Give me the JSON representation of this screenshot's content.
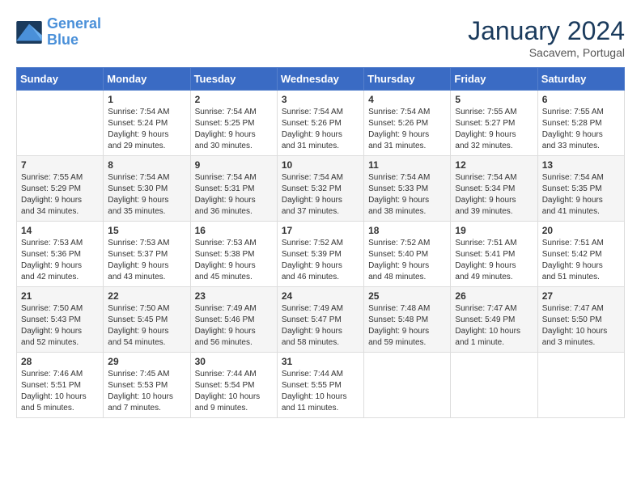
{
  "header": {
    "logo_line1": "General",
    "logo_line2": "Blue",
    "month_year": "January 2024",
    "location": "Sacavem, Portugal"
  },
  "weekdays": [
    "Sunday",
    "Monday",
    "Tuesday",
    "Wednesday",
    "Thursday",
    "Friday",
    "Saturday"
  ],
  "weeks": [
    [
      {
        "day": "",
        "info": ""
      },
      {
        "day": "1",
        "info": "Sunrise: 7:54 AM\nSunset: 5:24 PM\nDaylight: 9 hours\nand 29 minutes."
      },
      {
        "day": "2",
        "info": "Sunrise: 7:54 AM\nSunset: 5:25 PM\nDaylight: 9 hours\nand 30 minutes."
      },
      {
        "day": "3",
        "info": "Sunrise: 7:54 AM\nSunset: 5:26 PM\nDaylight: 9 hours\nand 31 minutes."
      },
      {
        "day": "4",
        "info": "Sunrise: 7:54 AM\nSunset: 5:26 PM\nDaylight: 9 hours\nand 31 minutes."
      },
      {
        "day": "5",
        "info": "Sunrise: 7:55 AM\nSunset: 5:27 PM\nDaylight: 9 hours\nand 32 minutes."
      },
      {
        "day": "6",
        "info": "Sunrise: 7:55 AM\nSunset: 5:28 PM\nDaylight: 9 hours\nand 33 minutes."
      }
    ],
    [
      {
        "day": "7",
        "info": "Sunrise: 7:55 AM\nSunset: 5:29 PM\nDaylight: 9 hours\nand 34 minutes."
      },
      {
        "day": "8",
        "info": "Sunrise: 7:54 AM\nSunset: 5:30 PM\nDaylight: 9 hours\nand 35 minutes."
      },
      {
        "day": "9",
        "info": "Sunrise: 7:54 AM\nSunset: 5:31 PM\nDaylight: 9 hours\nand 36 minutes."
      },
      {
        "day": "10",
        "info": "Sunrise: 7:54 AM\nSunset: 5:32 PM\nDaylight: 9 hours\nand 37 minutes."
      },
      {
        "day": "11",
        "info": "Sunrise: 7:54 AM\nSunset: 5:33 PM\nDaylight: 9 hours\nand 38 minutes."
      },
      {
        "day": "12",
        "info": "Sunrise: 7:54 AM\nSunset: 5:34 PM\nDaylight: 9 hours\nand 39 minutes."
      },
      {
        "day": "13",
        "info": "Sunrise: 7:54 AM\nSunset: 5:35 PM\nDaylight: 9 hours\nand 41 minutes."
      }
    ],
    [
      {
        "day": "14",
        "info": "Sunrise: 7:53 AM\nSunset: 5:36 PM\nDaylight: 9 hours\nand 42 minutes."
      },
      {
        "day": "15",
        "info": "Sunrise: 7:53 AM\nSunset: 5:37 PM\nDaylight: 9 hours\nand 43 minutes."
      },
      {
        "day": "16",
        "info": "Sunrise: 7:53 AM\nSunset: 5:38 PM\nDaylight: 9 hours\nand 45 minutes."
      },
      {
        "day": "17",
        "info": "Sunrise: 7:52 AM\nSunset: 5:39 PM\nDaylight: 9 hours\nand 46 minutes."
      },
      {
        "day": "18",
        "info": "Sunrise: 7:52 AM\nSunset: 5:40 PM\nDaylight: 9 hours\nand 48 minutes."
      },
      {
        "day": "19",
        "info": "Sunrise: 7:51 AM\nSunset: 5:41 PM\nDaylight: 9 hours\nand 49 minutes."
      },
      {
        "day": "20",
        "info": "Sunrise: 7:51 AM\nSunset: 5:42 PM\nDaylight: 9 hours\nand 51 minutes."
      }
    ],
    [
      {
        "day": "21",
        "info": "Sunrise: 7:50 AM\nSunset: 5:43 PM\nDaylight: 9 hours\nand 52 minutes."
      },
      {
        "day": "22",
        "info": "Sunrise: 7:50 AM\nSunset: 5:45 PM\nDaylight: 9 hours\nand 54 minutes."
      },
      {
        "day": "23",
        "info": "Sunrise: 7:49 AM\nSunset: 5:46 PM\nDaylight: 9 hours\nand 56 minutes."
      },
      {
        "day": "24",
        "info": "Sunrise: 7:49 AM\nSunset: 5:47 PM\nDaylight: 9 hours\nand 58 minutes."
      },
      {
        "day": "25",
        "info": "Sunrise: 7:48 AM\nSunset: 5:48 PM\nDaylight: 9 hours\nand 59 minutes."
      },
      {
        "day": "26",
        "info": "Sunrise: 7:47 AM\nSunset: 5:49 PM\nDaylight: 10 hours\nand 1 minute."
      },
      {
        "day": "27",
        "info": "Sunrise: 7:47 AM\nSunset: 5:50 PM\nDaylight: 10 hours\nand 3 minutes."
      }
    ],
    [
      {
        "day": "28",
        "info": "Sunrise: 7:46 AM\nSunset: 5:51 PM\nDaylight: 10 hours\nand 5 minutes."
      },
      {
        "day": "29",
        "info": "Sunrise: 7:45 AM\nSunset: 5:53 PM\nDaylight: 10 hours\nand 7 minutes."
      },
      {
        "day": "30",
        "info": "Sunrise: 7:44 AM\nSunset: 5:54 PM\nDaylight: 10 hours\nand 9 minutes."
      },
      {
        "day": "31",
        "info": "Sunrise: 7:44 AM\nSunset: 5:55 PM\nDaylight: 10 hours\nand 11 minutes."
      },
      {
        "day": "",
        "info": ""
      },
      {
        "day": "",
        "info": ""
      },
      {
        "day": "",
        "info": ""
      }
    ]
  ]
}
